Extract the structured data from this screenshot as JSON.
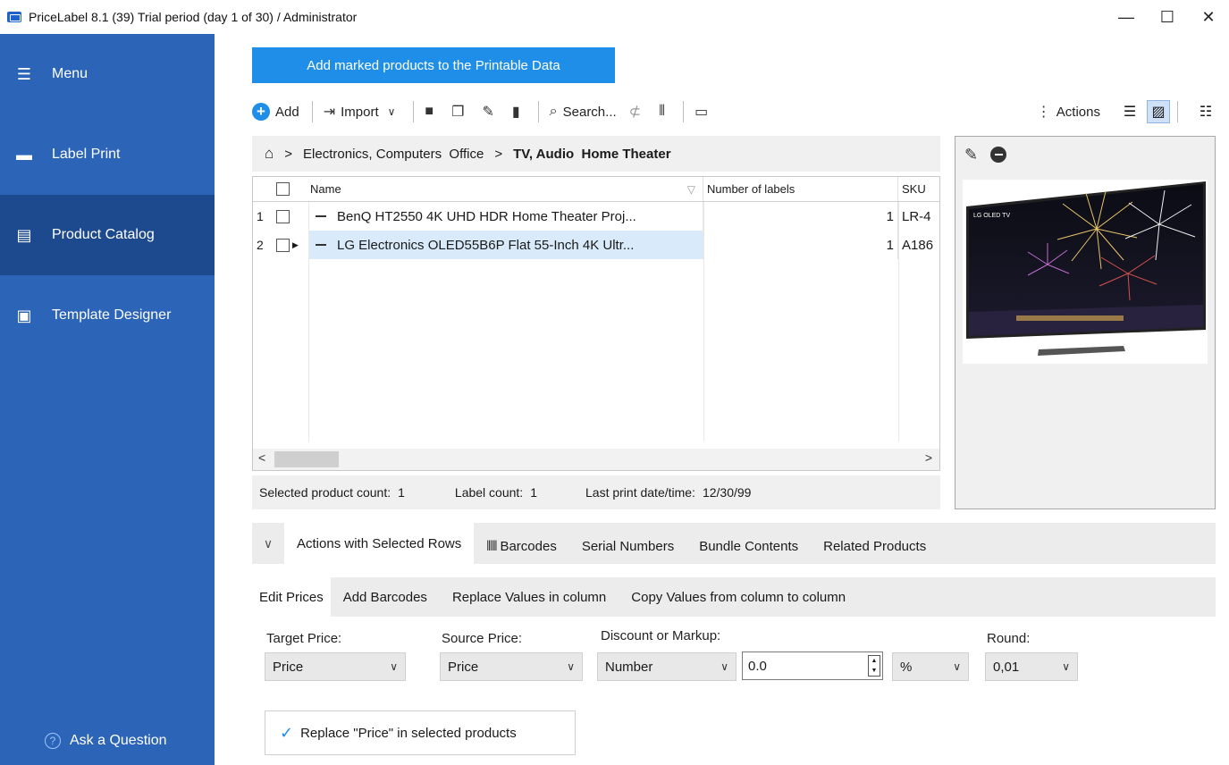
{
  "window": {
    "title": "PriceLabel 8.1 (39) Trial period (day 1 of 30) / Administrator",
    "min_glyph": "—",
    "max_glyph": "☐",
    "close_glyph": "✕"
  },
  "sidebar": {
    "items": [
      {
        "label": "Menu",
        "icon": "hamburger-icon"
      },
      {
        "label": "Label Print",
        "icon": "printer-icon"
      },
      {
        "label": "Product Catalog",
        "icon": "catalog-icon",
        "active": true
      },
      {
        "label": "Template Designer",
        "icon": "template-icon"
      }
    ],
    "ask_label": "Ask a Question",
    "ask_glyph": "?",
    "background": "#2c64b8",
    "active_background": "#1d4a8e"
  },
  "primary_button": {
    "label": "Add marked products to the Printable Data",
    "color": "#1e8ee8"
  },
  "toolbar": {
    "add": "Add",
    "import": "Import",
    "search": "Search...",
    "actions": "Actions"
  },
  "breadcrumb": {
    "sep": ">",
    "items": [
      "Electronics, Computers  Office",
      "TV, Audio  Home Theater"
    ]
  },
  "grid": {
    "columns": [
      "Name",
      "Number of labels",
      "SKU"
    ],
    "sort_glyph": "▽",
    "rows": [
      {
        "num": "1",
        "name": "BenQ HT2550 4K UHD HDR Home Theater Proj...",
        "labels": "1",
        "sku": "LR-4",
        "selected": false
      },
      {
        "num": "2",
        "name": "LG Electronics OLED55B6P Flat 55-Inch 4K Ultr...",
        "labels": "1",
        "sku": "A186",
        "selected": true
      }
    ],
    "scroll_left": "<",
    "scroll_right": ">"
  },
  "status": {
    "selected_label": "Selected product count:",
    "selected_value": "1",
    "label_count_label": "Label count:",
    "label_count_value": "1",
    "last_print_label": "Last print date/time:",
    "last_print_value": "12/30/99"
  },
  "preview": {
    "brand_text": "LG OLED TV"
  },
  "tabs_primary": {
    "items": [
      "Actions with Selected Rows",
      "Barcodes",
      "Serial Numbers",
      "Bundle Contents",
      "Related Products"
    ],
    "active_index": 0
  },
  "tabs_secondary": {
    "items": [
      "Edit Prices",
      "Add Barcodes",
      "Replace Values in column",
      "Copy Values from column to column"
    ],
    "active_index": 0
  },
  "form": {
    "target_label": "Target Price:",
    "target_value": "Price",
    "source_label": "Source Price:",
    "source_value": "Price",
    "discount_label": "Discount or Markup:",
    "discount_type": "Number",
    "amount": "0.0",
    "unit": "%",
    "round_label": "Round:",
    "round_value": "0,01"
  },
  "replace_button": {
    "label": "Replace \"Price\" in selected products",
    "glyph": "✓"
  }
}
